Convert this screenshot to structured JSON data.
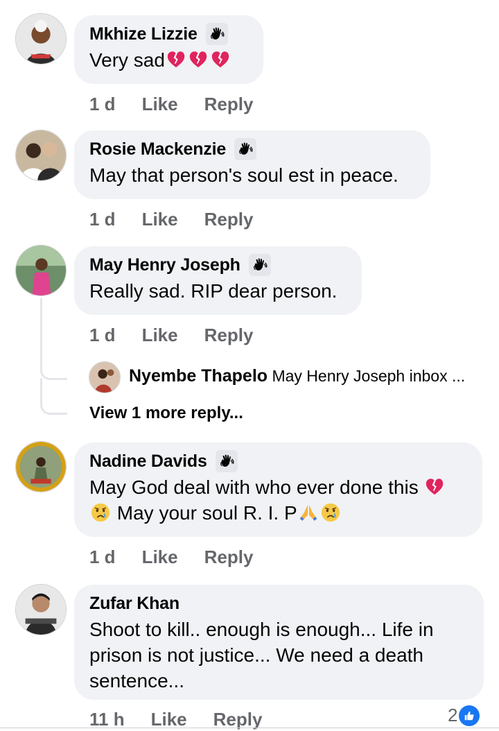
{
  "comments": [
    {
      "name": "Mkhize Lizzie",
      "text": "Very sad",
      "emojis": [
        "broken-heart",
        "broken-heart",
        "broken-heart"
      ],
      "time": "1 d",
      "like": "Like",
      "reply": "Reply"
    },
    {
      "name": "Rosie Mackenzie",
      "text": "May that person's soul est in peace.",
      "time": "1 d",
      "like": "Like",
      "reply": "Reply"
    },
    {
      "name": "May Henry Joseph",
      "text": "Really sad. RIP dear person.",
      "time": "1 d",
      "like": "Like",
      "reply": "Reply",
      "reply_preview": {
        "name": "Nyembe Thapelo",
        "text": "May Henry Joseph inbox ..."
      },
      "more_replies": "View 1 more reply..."
    },
    {
      "name": "Nadine Davids",
      "line1": "May God deal with who ever done this",
      "line2": " May your soul R. I. P",
      "emojis": [
        "broken-heart",
        "crying-face",
        "folded-hands",
        "crying-face"
      ],
      "time": "1 d",
      "like": "Like",
      "reply": "Reply"
    },
    {
      "name": "Zufar Khan",
      "text": "Shoot to kill.. enough is enough... Life in prison is not justice... We need a death sentence...",
      "time": "11 h",
      "like": "Like",
      "reply": "Reply",
      "reaction_count": "2"
    }
  ],
  "colors": {
    "bubble": "#f0f2f5",
    "meta": "#65676b",
    "like_blue": "#1877f2",
    "broken_heart": "#e0245e"
  }
}
